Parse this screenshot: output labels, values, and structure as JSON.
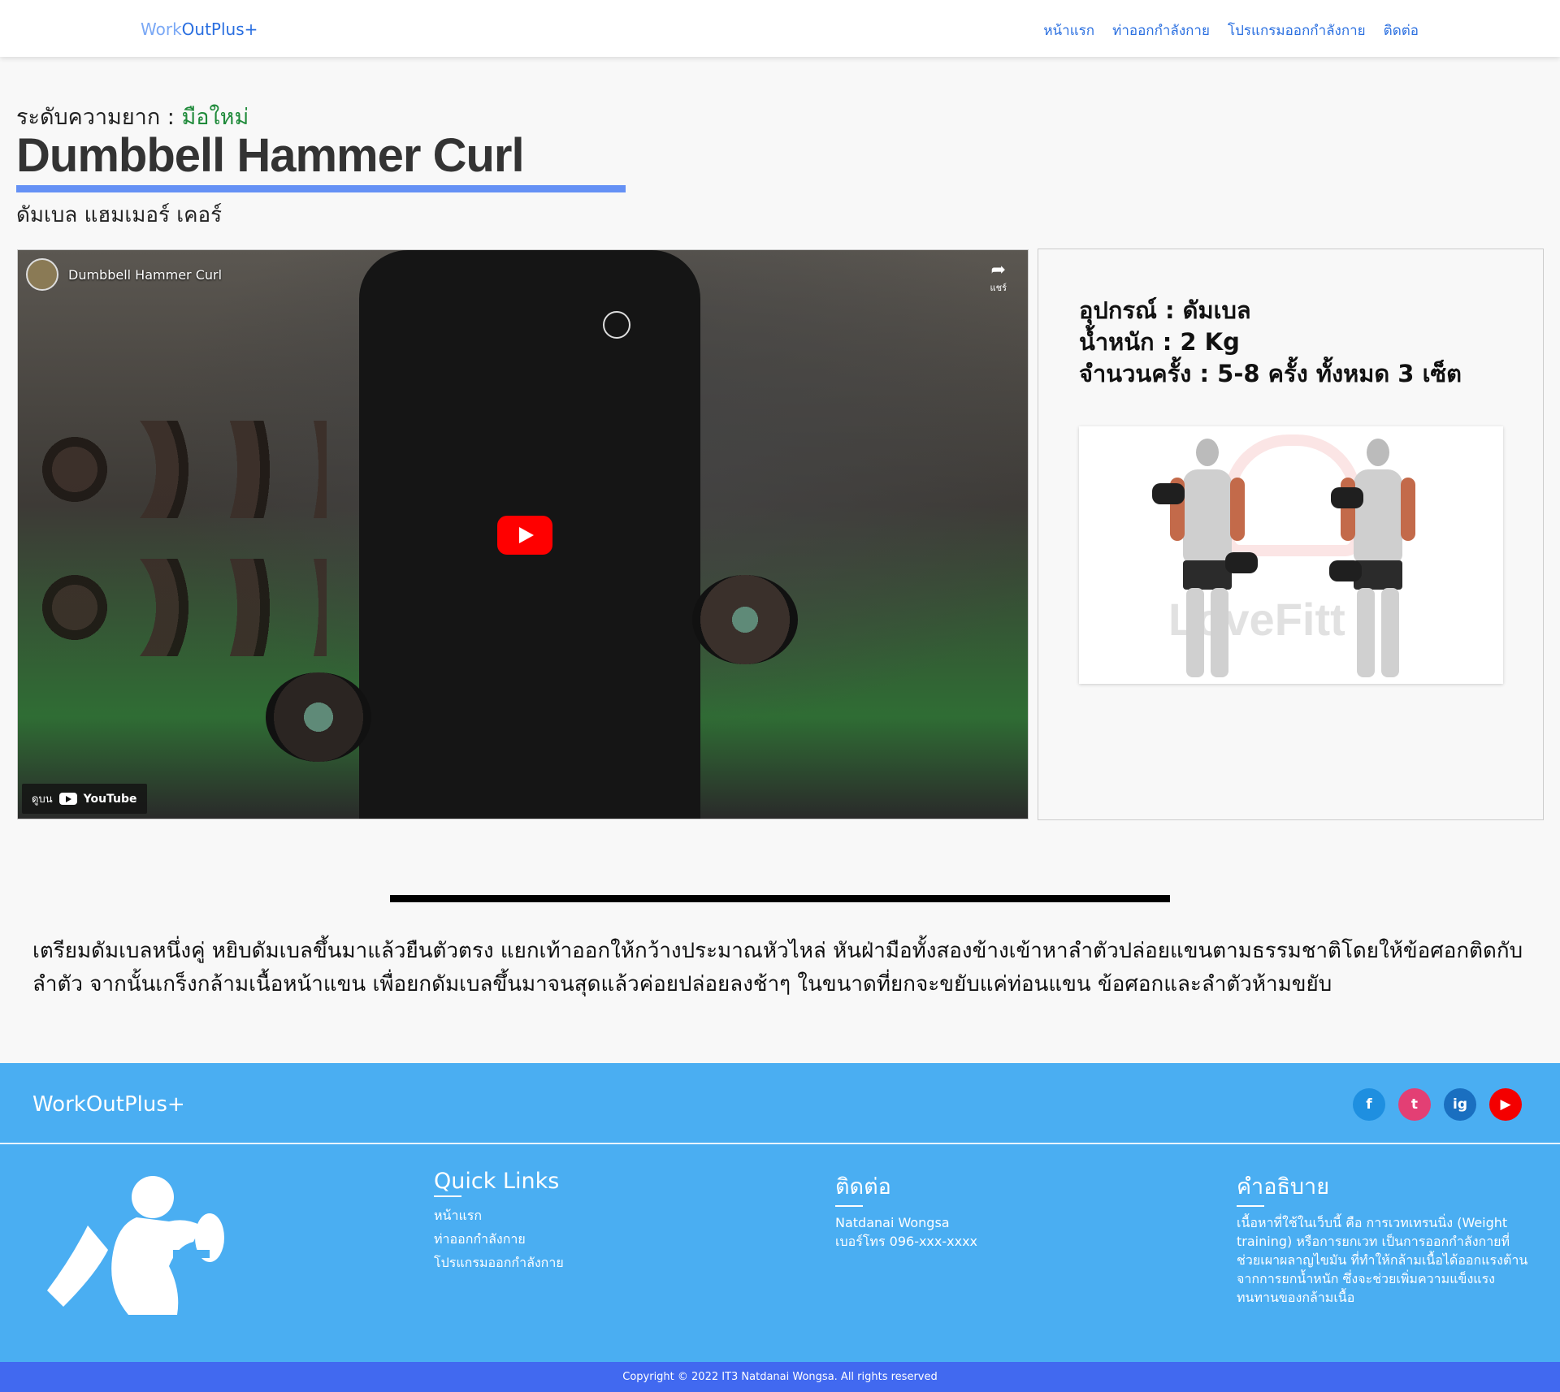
{
  "nav": {
    "brand_part1": "Work",
    "brand_part2": "OutPlus+",
    "links": [
      "หน้าแรก",
      "ท่าออกกำลังกาย",
      "โปรแกรมออกกำลังกาย",
      "ติดต่อ"
    ]
  },
  "exercise": {
    "difficulty_label": "ระดับความยาก :",
    "difficulty_value": "มือใหม่",
    "title": "Dumbbell Hammer Curl",
    "subtitle": "ดัมเบล แฮมเมอร์ เคอร์"
  },
  "video": {
    "title": "Dumbbell Hammer Curl",
    "share_label": "แชร์",
    "watch_on": "ดูบน",
    "youtube_label": "YouTube"
  },
  "info": {
    "equipment": "อุปกรณ์ : ดัมเบล",
    "weight": "น้ำหนัก : 2 Kg",
    "reps": "จำนวนครั้ง : 5-8 ครั้ง ทั้งหมด 3 เซ็ต",
    "image_watermark": "LoveFitt"
  },
  "description": "เตรียมดัมเบลหนึ่งคู่ หยิบดัมเบลขึ้นมาแล้วยืนตัวตรง แยกเท้าออกให้กว้างประมาณหัวไหล่ หันฝ่ามือทั้งสองข้างเข้าหาลำตัวปล่อยแขนตามธรรมชาติโดยให้ข้อศอกติดกับลำตัว จากนั้นเกร็งกล้ามเนื้อหน้าแขน เพื่อยกดัมเบลขึ้นมาจนสุดแล้วค่อยปล่อยลงช้าๆ ในขนาดที่ยกจะขยับแค่ท่อนแขน ข้อศอกและลำตัวห้ามขยับ",
  "footer": {
    "brand": "WorkOutPlus+",
    "socials": [
      "f",
      "t",
      "ig",
      "▶"
    ],
    "quick_links_title": "Quick Links",
    "quick_links": [
      "หน้าแรก",
      "ท่าออกกำลังกาย",
      "โปรแกรมออกกำลังกาย"
    ],
    "contact_title": "ติดต่อ",
    "contact_name": "Natdanai Wongsa",
    "contact_phone": "เบอร์โทร 096-xxx-xxxx",
    "about_title": "คำอธิบาย",
    "about_text": "เนื้อหาที่ใช้ในเว็บนี้ คือ การเวทเทรนนิ่ง (Weight training) หรือการยกเวท เป็นการออกกำลังกายที่ช่วยเผาผลาญไขมัน ที่ทำให้กล้ามเนื้อได้ออกแรงต้าน จากการยกน้ำหนัก ซึ่งจะช่วยเพิ่มความแข็งแรงทนทานของกล้ามเนื้อ",
    "copyright": "Copyright © 2022 IT3 Natdanai Wongsa. All rights reserved"
  },
  "colors": {
    "nav_link": "#2a6fe0",
    "difficulty": "#1f8a3a",
    "title_bar": "#6591f5",
    "footer_bg": "#4aaef2",
    "copyright_bg": "#4169f0"
  }
}
